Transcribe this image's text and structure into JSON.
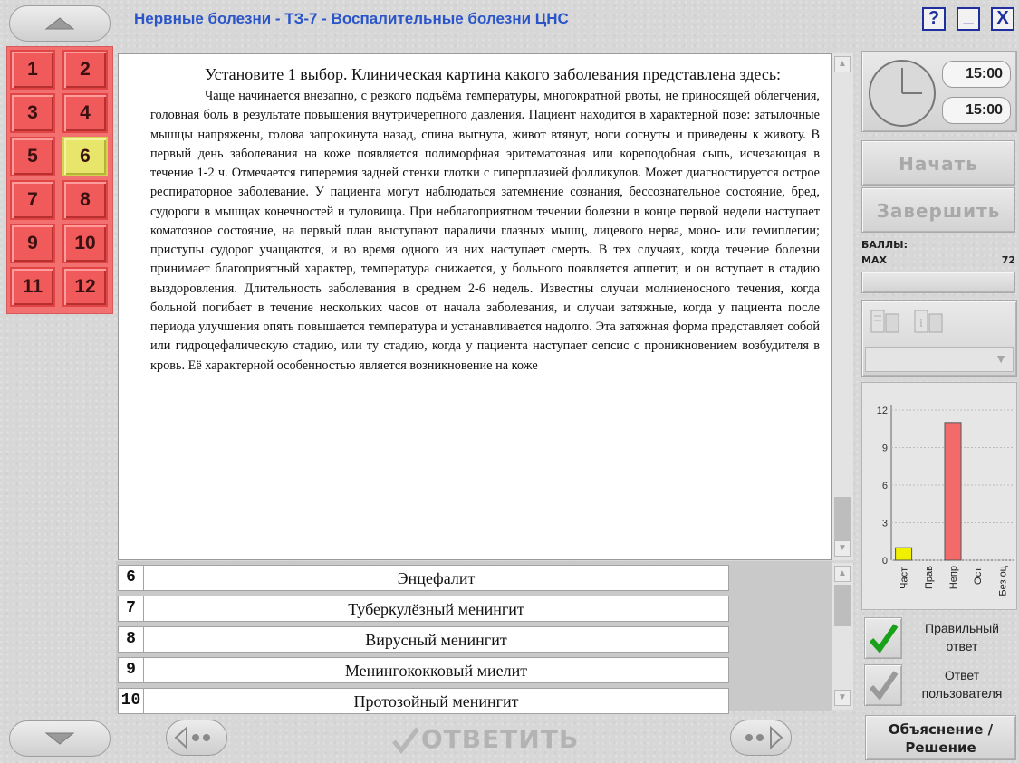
{
  "window": {
    "title": "Нервные болезни - ТЗ-7 - Воспалительные болезни ЦНС",
    "help_label": "?",
    "minimize_label": "_",
    "close_label": "X"
  },
  "question_nav": {
    "items": [
      {
        "label": "1"
      },
      {
        "label": "2"
      },
      {
        "label": "3"
      },
      {
        "label": "4"
      },
      {
        "label": "5"
      },
      {
        "label": "6",
        "active": true
      },
      {
        "label": "7"
      },
      {
        "label": "8"
      },
      {
        "label": "9"
      },
      {
        "label": "10"
      },
      {
        "label": "11"
      },
      {
        "label": "12"
      }
    ]
  },
  "question": {
    "header": "Установите 1 выбор. Клиническая картина какого заболевания представлена здесь:",
    "body": "Чаще начинается внезапно, с резкого подъёма температуры, многократной рвоты, не приносящей облегчения, головная боль в результате повышения внутричерепного давления. Пациент находится в характерной позе: затылочные мышцы напряжены, голова запрокинута назад, спина выгнута, живот втянут, ноги согнуты и приведены к животу. В первый день заболевания на коже появляется полиморфная эритематозная или кореподобная сыпь, исчезающая в течение 1-2 ч. Отмечается гиперемия задней стенки глотки с гиперплазией фолликулов. Может диагностируется острое респираторное заболевание. У пациента могут наблюдаться затемнение сознания, бессознательное состояние, бред, судороги в мышцах конечностей и туловища. При неблагоприятном течении болезни в конце первой недели наступает коматозное состояние, на первый план выступают параличи глазных мышц, лицевого нерва, моно- или гемиплегии; приступы судорог учащаются, и во время одного из них наступает смерть. В тех случаях, когда течение болезни принимает благоприятный характер, температура снижается, у больного появляется аппетит, и он вступает в стадию выздоровления. Длительность заболевания в среднем 2-6 недель. Известны случаи молниеносного течения, когда больной погибает в течение нескольких часов от начала заболевания, и случаи затяжные, когда у пациента после периода улучшения опять повышается температура и устанавливается надолго. Эта затяжная форма представляет собой или гидроцефалическую стадию, или ту стадию, когда у пациента наступает сепсис с проникновением возбудителя в кровь. Её характерной особенностью является возникновение на коже"
  },
  "answers": [
    {
      "num": "6",
      "text": "Энцефалит"
    },
    {
      "num": "7",
      "text": "Туберкулёзный менингит"
    },
    {
      "num": "8",
      "text": "Вирусный менингит"
    },
    {
      "num": "9",
      "text": "Менингококковый миелит"
    },
    {
      "num": "10",
      "text": "Протозойный менингит"
    }
  ],
  "timer": {
    "elapsed": "15:00",
    "total": "15:00"
  },
  "controls": {
    "start_label": "Начать",
    "finish_label": "Завершить",
    "answer_label": "ОТВЕТИТЬ",
    "explain_label_line1": "Объяснение /",
    "explain_label_line2": "Решение"
  },
  "score": {
    "label": "БАЛЛЫ:",
    "max_label": "MAX",
    "max_value": "72"
  },
  "legend": {
    "correct_line1": "Правильный",
    "correct_line2": "ответ",
    "user_line1": "Ответ",
    "user_line2": "пользователя"
  },
  "colors": {
    "accent_blue": "#2a55c9",
    "question_red": "#f05a5a",
    "active_yellow": "#e7e66a",
    "bar_red": "#f26a6a",
    "bar_yellow": "#f1f000",
    "check_green": "#1aa11a"
  },
  "chart_data": {
    "type": "bar",
    "categories": [
      "Част.",
      "Прав",
      "Непр",
      "Ост.",
      "Без оц"
    ],
    "values": [
      1,
      0,
      11,
      0,
      0
    ],
    "ylim": [
      0,
      12
    ],
    "yticks": [
      "0",
      "3",
      "6",
      "9",
      "12"
    ],
    "colors": [
      "#f1f000",
      "#f1f000",
      "#f26a6a",
      "#f26a6a",
      "#f26a6a"
    ]
  }
}
